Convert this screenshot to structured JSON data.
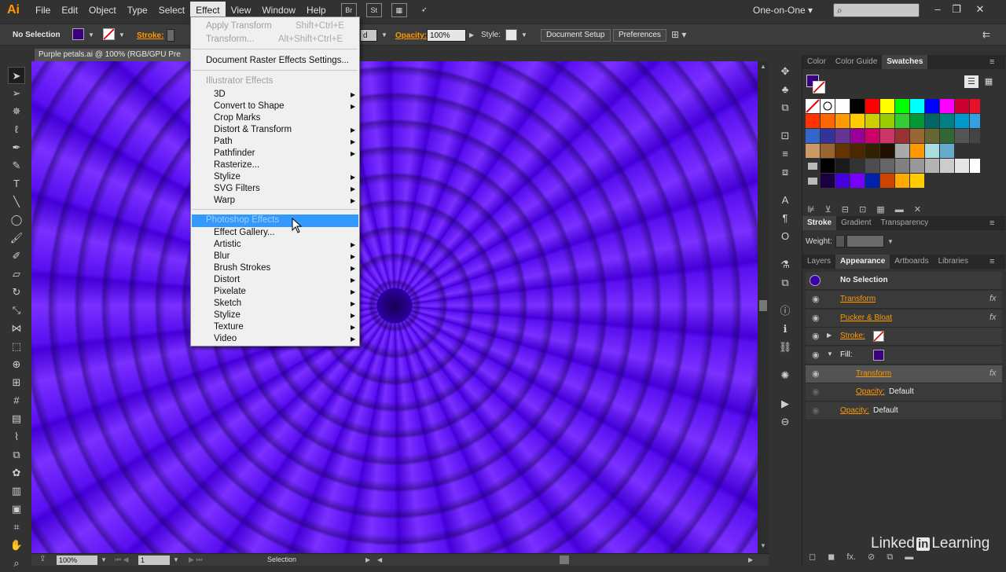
{
  "app": {
    "logo": "Ai"
  },
  "menubar": {
    "items": [
      "File",
      "Edit",
      "Object",
      "Type",
      "Select",
      "Effect",
      "View",
      "Window",
      "Help"
    ],
    "bridge_icon": "Br",
    "stock_icon": "St",
    "workspace": "One-on-One"
  },
  "controlbar": {
    "selection_label": "No Selection",
    "stroke_label": "Stroke:",
    "style_suffix": "d",
    "opacity_label": "Opacity:",
    "opacity_value": "100%",
    "style_label": "Style:",
    "document_setup": "Document Setup",
    "preferences": "Preferences"
  },
  "document": {
    "tab_title": "Purple petals.ai @ 100% (RGB/GPU Pre",
    "zoom": "100%",
    "page": "1",
    "status": "Selection"
  },
  "effect_menu": {
    "apply_transform": "Apply Transform",
    "apply_transform_shortcut": "Shift+Ctrl+E",
    "transform": "Transform...",
    "transform_shortcut": "Alt+Shift+Ctrl+E",
    "raster_settings": "Document Raster Effects Settings...",
    "illustrator_effects": "Illustrator Effects",
    "illustrator_items": [
      "3D",
      "Convert to Shape",
      "Crop Marks",
      "Distort & Transform",
      "Path",
      "Pathfinder",
      "Rasterize...",
      "Stylize",
      "SVG Filters",
      "Warp"
    ],
    "photoshop_effects": "Photoshop Effects",
    "photoshop_items": [
      "Effect Gallery...",
      "Artistic",
      "Blur",
      "Brush Strokes",
      "Distort",
      "Pixelate",
      "Sketch",
      "Stylize",
      "Texture",
      "Video"
    ]
  },
  "panels": {
    "swatch_tabs": [
      "Color",
      "Color Guide",
      "Swatches"
    ],
    "stroke_tabs": [
      "Stroke",
      "Gradient",
      "Transparency"
    ],
    "weight_label": "Weight:",
    "appearance_tabs": [
      "Layers",
      "Appearance",
      "Artboards",
      "Libraries"
    ],
    "appearance": {
      "header": "No Selection",
      "rows": [
        "Transform",
        "Pucker & Bloat",
        "Stroke:",
        "Fill:",
        "Transform",
        "Opacity:",
        "Opacity:"
      ],
      "default_value": "Default"
    }
  },
  "watermark": {
    "brand_a": "Linked",
    "brand_in": "in",
    "brand_b": "Learning"
  }
}
